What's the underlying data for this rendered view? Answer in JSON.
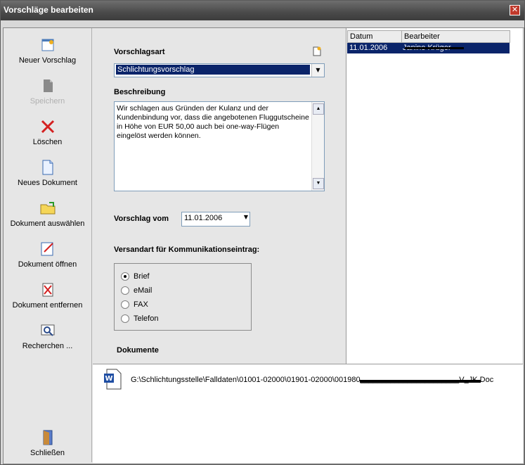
{
  "window": {
    "title": "Vorschläge bearbeiten",
    "close": "✕"
  },
  "sidebar": {
    "new_proposal": "Neuer Vorschlag",
    "save": "Speichern",
    "delete": "Löschen",
    "new_doc": "Neues Dokument",
    "select_doc": "Dokument auswählen",
    "open_doc": "Dokument öffnen",
    "remove_doc": "Dokument entfernen",
    "research": "Recherchen ...",
    "close": "Schließen"
  },
  "form": {
    "type_label": "Vorschlagsart",
    "type_value": "Schlichtungsvorschlag",
    "desc_label": "Beschreibung",
    "desc_text": "Wir schlagen aus Gründen der Kulanz und der Kundenbindung vor, dass die angebotenen Fluggutscheine in Höhe von EUR 50,00 auch bei one-way-Flügen eingelöst werden können.",
    "date_label": "Vorschlag vom",
    "date_value": "11.01.2006",
    "send_label": "Versandart für Kommunikationseintrag:",
    "send_options": [
      "Brief",
      "eMail",
      "FAX",
      "Telefon"
    ],
    "send_selected": "Brief",
    "docs_label": "Dokumente"
  },
  "grid": {
    "headers": [
      "Datum",
      "Bearbeiter"
    ],
    "rows": [
      {
        "datum": "11.01.2006",
        "bearbeiter": "Janine Krüger"
      }
    ]
  },
  "documents": {
    "path": "G:\\Schlichtungsstelle\\Falldaten\\01001-02000\\01901-02000\\001980_______________________V_JK.Doc"
  }
}
